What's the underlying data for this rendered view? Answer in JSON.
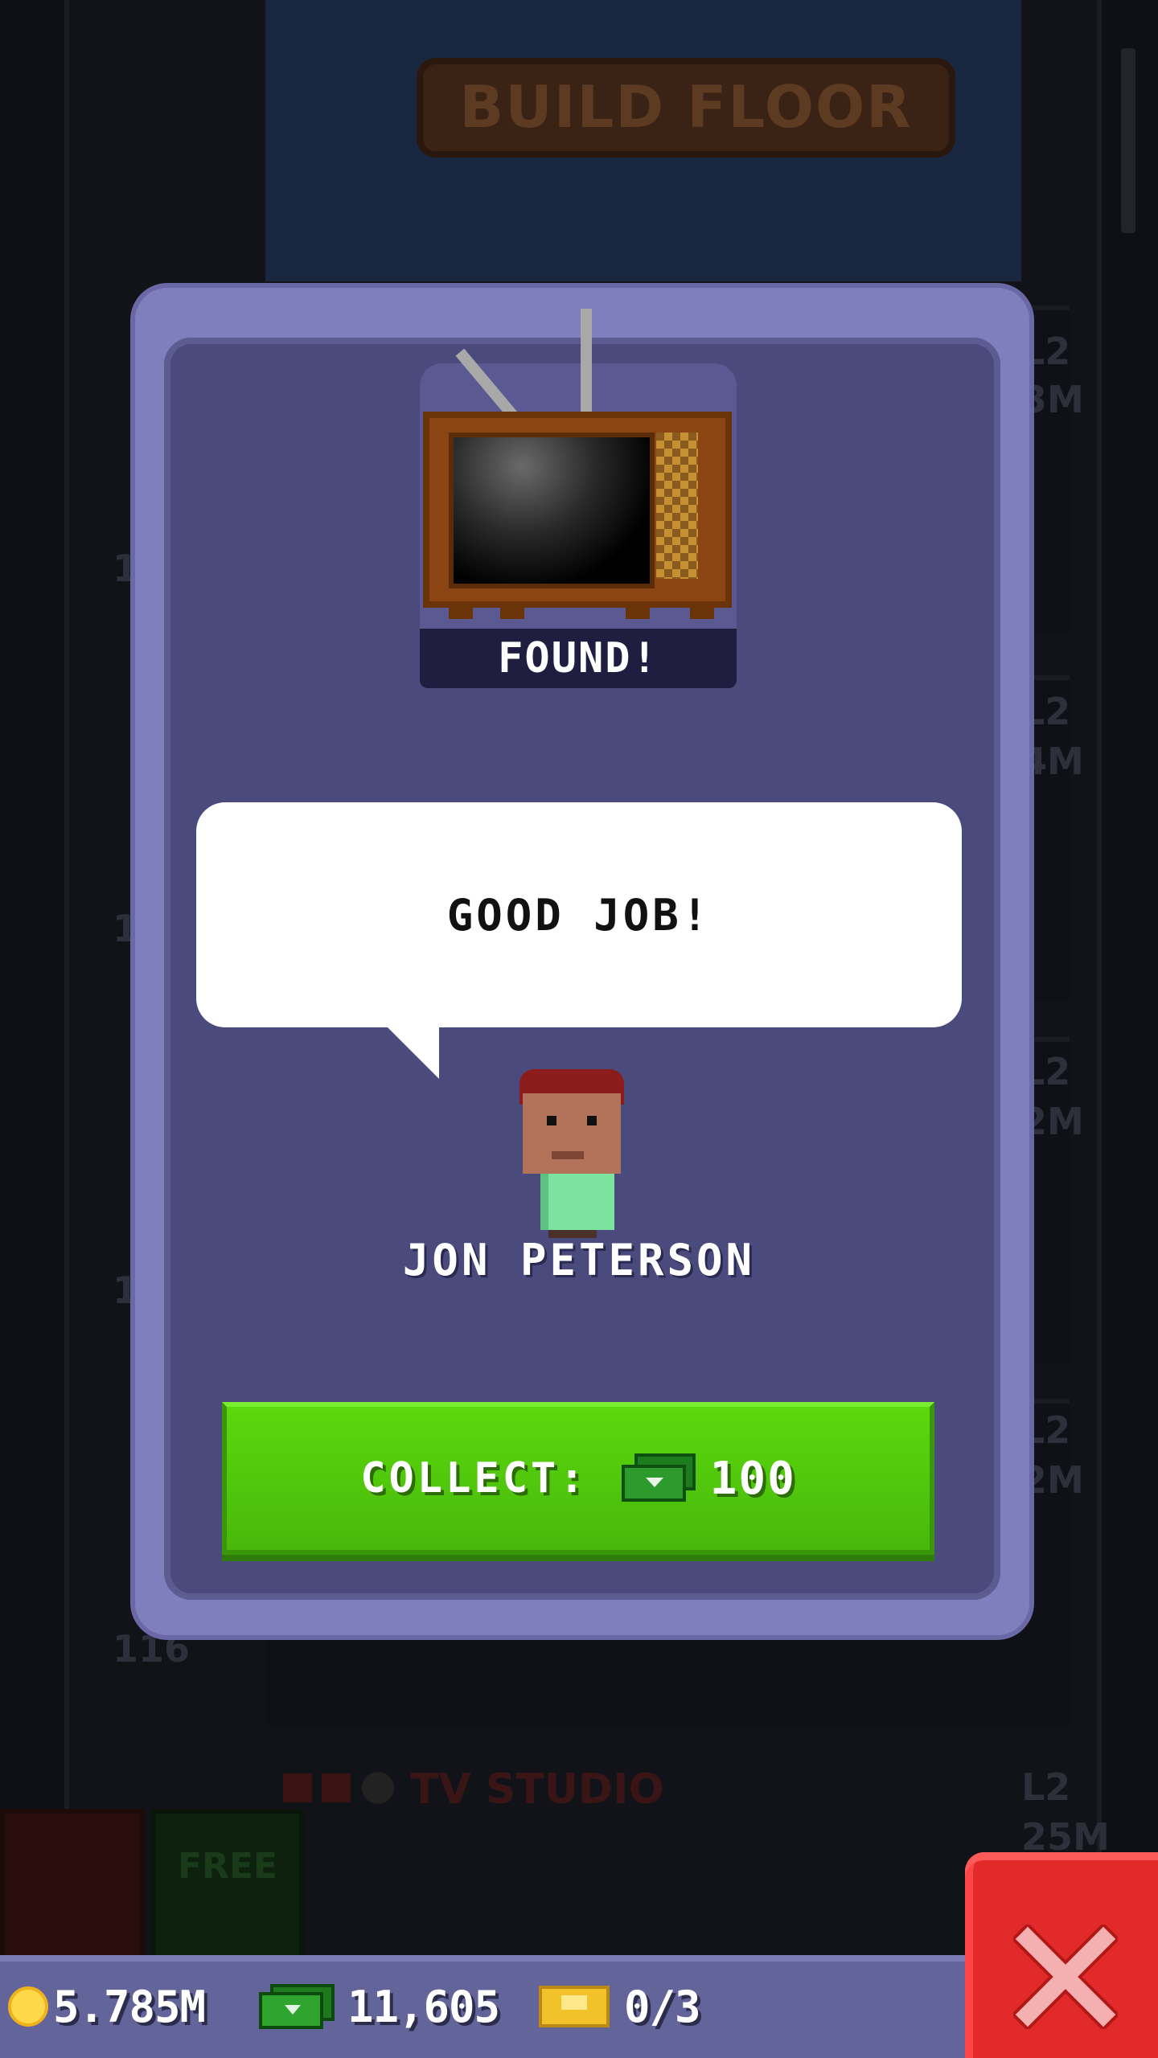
{
  "background": {
    "build_sign": "BUILD FLOOR",
    "floor_numbers": [
      "1",
      "1",
      "1",
      "116"
    ],
    "floor_levels": [
      "L2",
      "L2",
      "L2",
      "L2",
      "L2"
    ],
    "floor_values": [
      "3M",
      "4M",
      "2M",
      "2M",
      "25M"
    ],
    "floor_name": "TV STUDIO",
    "free_label": "FREE"
  },
  "modal": {
    "found_label": "FOUND!",
    "item_icon": "television-icon",
    "speech_text": "GOOD JOB!",
    "character_name": "JON PETERSON",
    "collect_label": "COLLECT:",
    "collect_amount": "100",
    "collect_currency_icon": "tower-bux-icon"
  },
  "status_bar": {
    "coins": "5.785M",
    "bux": "11,605",
    "tickets": "0/3"
  },
  "close_button": {
    "icon": "close-icon"
  },
  "colors": {
    "modal_border": "#807fbe",
    "modal_fill": "#4b4a7c",
    "collect_green": "#52c80c",
    "close_red": "#e32a2a",
    "status_bar": "#63649a"
  }
}
